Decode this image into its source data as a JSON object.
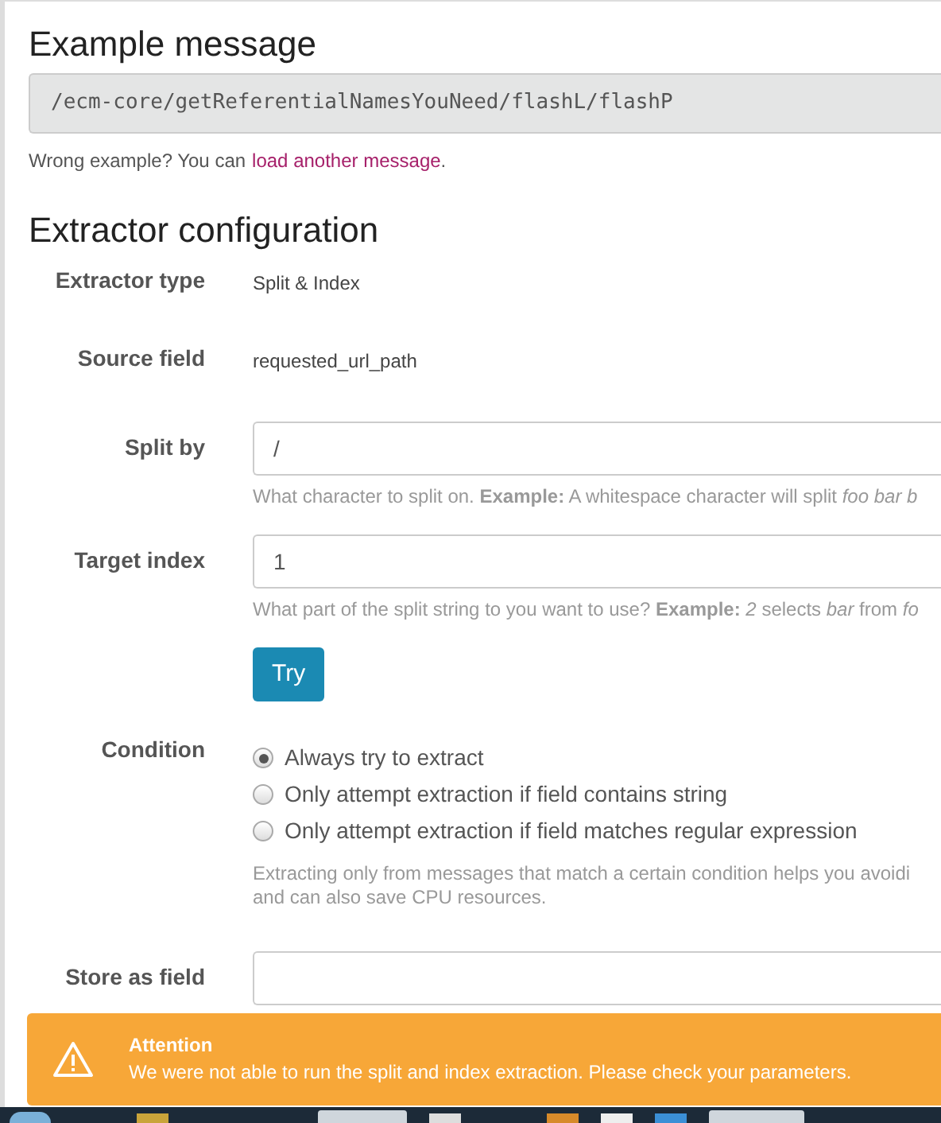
{
  "example": {
    "title": "Example message",
    "message": "/ecm-core/getReferentialNamesYouNeed/flashL/flashP",
    "note_before": "Wrong example? You can",
    "link": "load another message",
    "note_after": "."
  },
  "config": {
    "title": "Extractor configuration",
    "fields": [
      {
        "kind": "static",
        "label": "Extractor type",
        "value": "Split & Index"
      },
      {
        "kind": "static",
        "label": "Source field",
        "value": "requested_url_path"
      },
      {
        "kind": "input",
        "label": "Split by",
        "value": "/",
        "help_lines": [
          "What character to split on. **Example:** A whitespace character will split *foo bar b*"
        ]
      },
      {
        "kind": "input",
        "label": "Target index",
        "value": "1",
        "help_lines": [
          "What part of the split string to you want to use? **Example:** *2* selects *bar* from *fo*"
        ]
      },
      {
        "kind": "button",
        "label": "Try"
      },
      {
        "kind": "radio",
        "label": "Condition",
        "options": [
          {
            "label": "Always try to extract",
            "selected": true
          },
          {
            "label": "Only attempt extraction if field contains string",
            "selected": false
          },
          {
            "label": "Only attempt extraction if field matches regular expression",
            "selected": false
          }
        ],
        "help_lines": [
          "Extracting only from messages that match a certain condition helps you avoidi",
          "and can also save CPU resources."
        ]
      },
      {
        "kind": "input",
        "label": "Store as field"
      }
    ]
  },
  "notification": {
    "title": "Attention",
    "message": "We were not able to run the split and index extraction. Please check your parameters."
  }
}
